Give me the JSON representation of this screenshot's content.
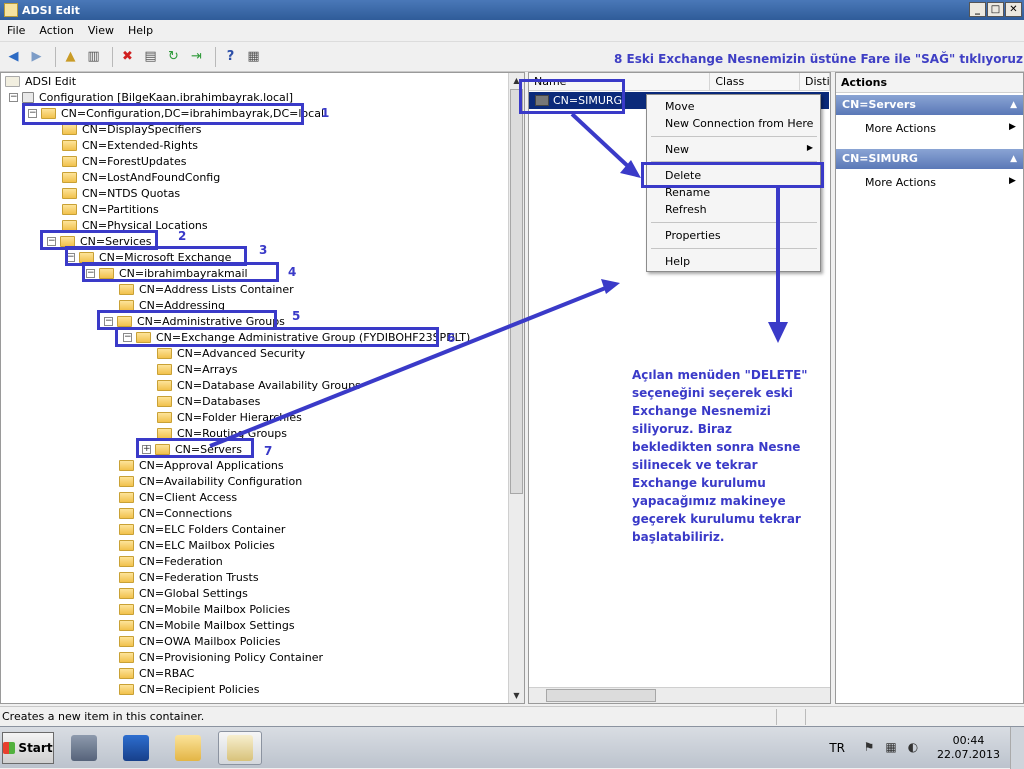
{
  "window": {
    "title": "ADSI Edit",
    "min": "_",
    "max": "□",
    "close": "✕"
  },
  "menu": [
    "File",
    "Action",
    "View",
    "Help"
  ],
  "caption": "8 Eski Exchange Nesnemizin üstüne Fare ile \"SAĞ\" tıklıyoruz",
  "tree": {
    "root": "ADSI Edit",
    "config": "Configuration [BilgeKaan.ibrahimbayrak.local]",
    "cn_config": "CN=Configuration,DC=ibrahimbayrak,DC=local",
    "level1": [
      "CN=DisplaySpecifiers",
      "CN=Extended-Rights",
      "CN=ForestUpdates",
      "CN=LostAndFoundConfig",
      "CN=NTDS Quotas",
      "CN=Partitions",
      "CN=Physical Locations"
    ],
    "services": "CN=Services",
    "msexchange": "CN=Microsoft Exchange",
    "org": "CN=ibrahimbayrakmail",
    "org_children_top": [
      "CN=Address Lists Container",
      "CN=Addressing"
    ],
    "admin_groups": "CN=Administrative Groups",
    "exag": "CN=Exchange Administrative Group (FYDIBOHF23SPDLT)",
    "exag_children": [
      "CN=Advanced Security",
      "CN=Arrays",
      "CN=Database Availability Groups",
      "CN=Databases",
      "CN=Folder Hierarchies",
      "CN=Routing Groups"
    ],
    "servers": "CN=Servers",
    "org_children_bottom": [
      "CN=Approval Applications",
      "CN=Availability Configuration",
      "CN=Client Access",
      "CN=Connections",
      "CN=ELC Folders Container",
      "CN=ELC Mailbox Policies",
      "CN=Federation",
      "CN=Federation Trusts",
      "CN=Global Settings",
      "CN=Mobile Mailbox Policies",
      "CN=Mobile Mailbox Settings",
      "CN=OWA Mailbox Policies",
      "CN=Provisioning Policy Container",
      "CN=RBAC",
      "CN=Recipient Policies"
    ]
  },
  "step_numbers": [
    "1",
    "2",
    "3",
    "4",
    "5",
    "6",
    "7"
  ],
  "list": {
    "columns": [
      "Name",
      "Class",
      "Distin"
    ],
    "row": "CN=SIMURG"
  },
  "context_menu": {
    "move": "Move",
    "new_conn": "New Connection from Here",
    "new": "New",
    "delete": "Delete",
    "rename": "Rename",
    "refresh": "Refresh",
    "properties": "Properties",
    "help": "Help"
  },
  "actions": {
    "header": "Actions",
    "sec1": "CN=Servers",
    "sec1_item": "More Actions",
    "sec2": "CN=SIMURG",
    "sec2_item": "More Actions"
  },
  "note": "Açılan menüden \"DELETE\" seçeneğini seçerek eski Exchange Nesnemizi siliyoruz. Biraz bekledikten sonra Nesne silinecek ve tekrar Exchange kurulumu yapacağımız makineye geçerek kurulumu tekrar başlatabiliriz.",
  "status_text": "Creates a new item in this container.",
  "taskbar": {
    "start": "Start",
    "lang": "TR",
    "time": "00:44",
    "date": "22.07.2013"
  },
  "colors": {
    "annotation": "#3a3ac8",
    "selection": "#0b2a7a",
    "caption": "#3f3fc4"
  }
}
